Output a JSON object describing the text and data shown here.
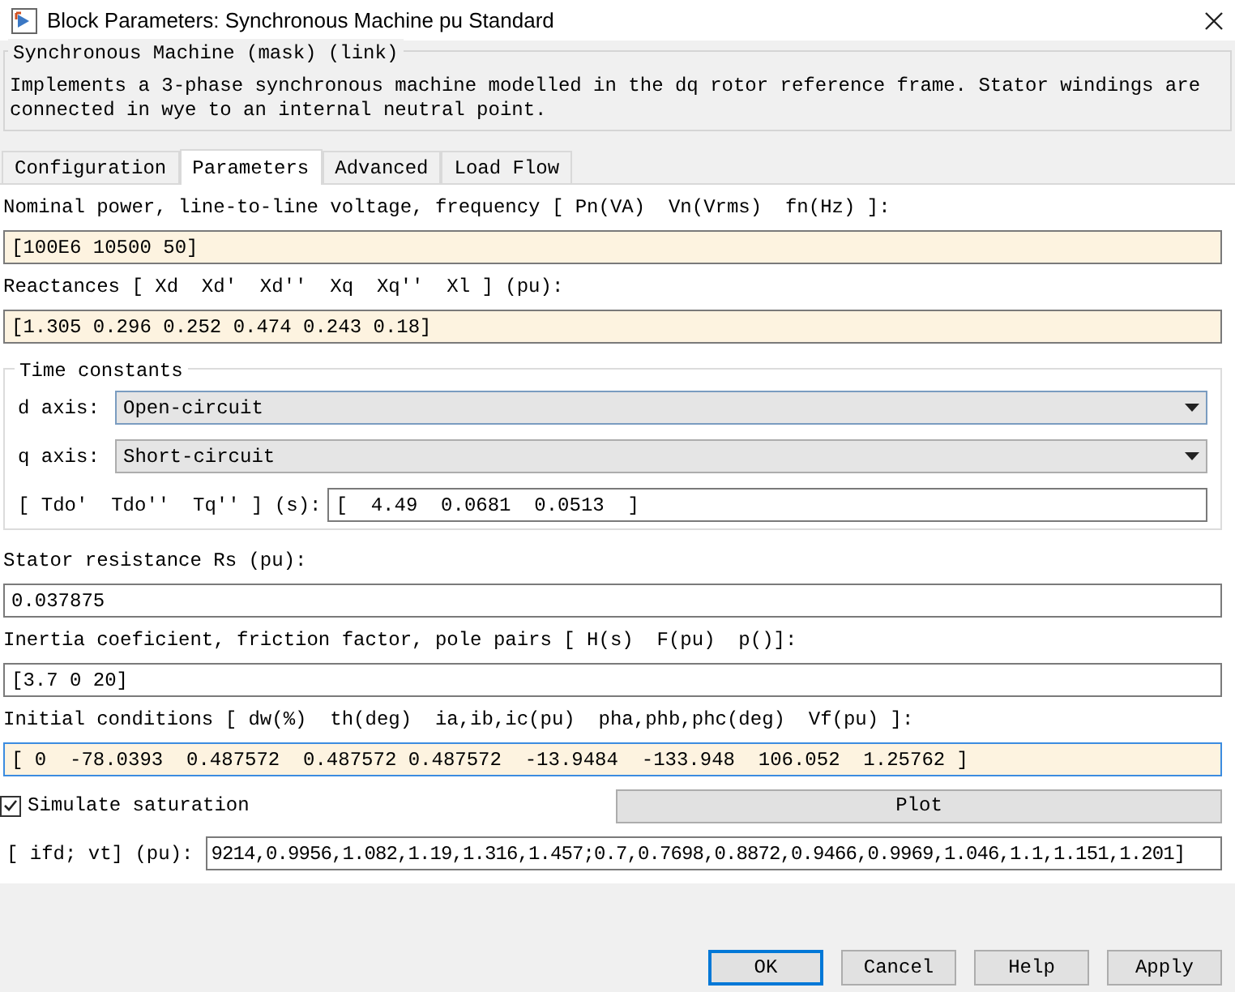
{
  "window": {
    "title": "Block Parameters: Synchronous Machine pu Standard"
  },
  "mask": {
    "title": "Synchronous Machine (mask) (link)",
    "description": "Implements a 3-phase synchronous machine modelled in the dq rotor reference frame. Stator windings are connected in wye to an internal neutral point."
  },
  "tabs": [
    {
      "label": "Configuration",
      "selected": false
    },
    {
      "label": "Parameters",
      "selected": true
    },
    {
      "label": "Advanced",
      "selected": false
    },
    {
      "label": "Load Flow",
      "selected": false
    }
  ],
  "params_top": [
    {
      "label": "Nominal power, line-to-line voltage, frequency [ Pn(VA)  Vn(Vrms)  fn(Hz) ]:",
      "value": "[100E6 10500 50]",
      "edited": true,
      "focused": false
    },
    {
      "label": "Reactances [ Xd  Xd'  Xd''  Xq  Xq''  Xl ] (pu):",
      "value": "[1.305 0.296 0.252 0.474 0.243 0.18]",
      "edited": true,
      "focused": false
    }
  ],
  "time_constants": {
    "title": "Time constants",
    "d_axis": {
      "label": "d axis:",
      "value": "Open-circuit",
      "focused": true
    },
    "q_axis": {
      "label": "q axis:",
      "value": "Short-circuit",
      "focused": false
    },
    "t": {
      "label": "[ Tdo'  Tdo''  Tq'' ] (s):",
      "value": "[  4.49  0.0681  0.0513  ]"
    }
  },
  "params_bottom": [
    {
      "label": "Stator resistance Rs (pu):",
      "value": "0.037875",
      "edited": false,
      "focused": false
    },
    {
      "label": "Inertia coeficient, friction factor, pole pairs [ H(s)  F(pu)  p()]:",
      "value": "[3.7 0 20]",
      "edited": false,
      "focused": false
    },
    {
      "label": "Initial conditions [ dw(%)  th(deg)  ia,ib,ic(pu)  pha,phb,phc(deg)  Vf(pu) ]:",
      "value": "[ 0  -78.0393  0.487572  0.487572 0.487572  -13.9484  -133.948  106.052  1.25762 ]",
      "edited": true,
      "focused": true
    }
  ],
  "saturation": {
    "label": "Simulate saturation",
    "checked": true,
    "plot_button": "Plot",
    "ifd_label": "[ ifd; vt] (pu):",
    "ifd_value": "9214,0.9956,1.082,1.19,1.316,1.457;0.7,0.7698,0.8872,0.9466,0.9969,1.046,1.1,1.151,1.201]"
  },
  "buttons": [
    {
      "label": "OK",
      "default": true
    },
    {
      "label": "Cancel",
      "default": false
    },
    {
      "label": "Help",
      "default": false
    },
    {
      "label": "Apply",
      "default": false
    }
  ]
}
